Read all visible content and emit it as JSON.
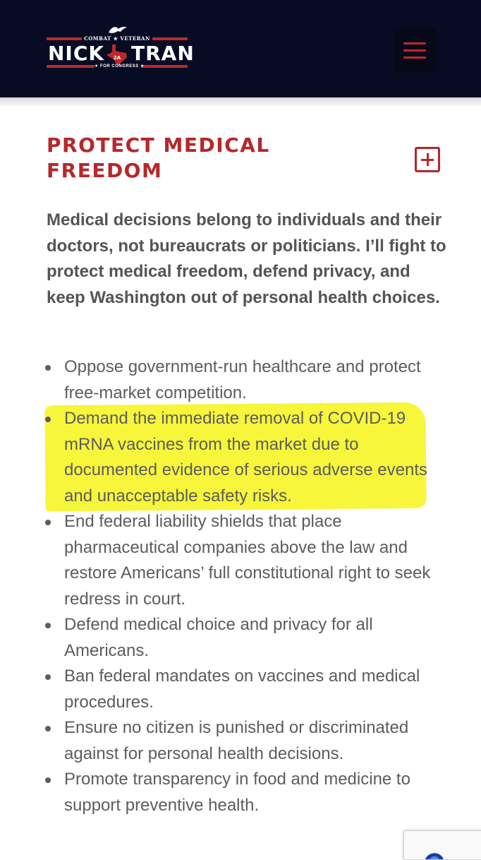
{
  "header": {
    "logo": {
      "tagline_top": "COMBAT ★ VETERAN",
      "name_first": "NICK",
      "name_last": "TRAN",
      "emblem_text": "2A",
      "tagline_bottom": "★ FOR CONGRESS ★"
    },
    "menu_icon": "hamburger-menu-icon"
  },
  "section": {
    "title": "PROTECT MEDICAL FREEDOM",
    "expand_icon": "plus-square-icon",
    "intro": "Medical decisions belong to individuals and their doctors, not bureaucrats or politicians. I’ll fight to protect medical freedom, defend privacy, and keep Washington out of personal health choices.",
    "items": [
      "Oppose government-run healthcare and protect free-market competition.",
      "Demand the immediate removal of COVID-19 mRNA vaccines from the market due to documented evidence of serious adverse events and unacceptable safety risks.",
      "End federal liability shields that place pharmaceutical companies above the law and restore Americans’ full constitutional right to seek redress in court.",
      "Defend medical choice and privacy for all Americans.",
      "Ban federal mandates on vaccines and medical procedures.",
      "Ensure no citizen is punished or discriminated against for personal health decisions.",
      "Promote transparency in food and medicine to support preventive health."
    ],
    "highlighted_item_index": 1
  },
  "colors": {
    "header_bg": "#070b24",
    "accent_red": "#b5282b",
    "body_text": "#5c5c61",
    "highlight": "#f7f63a"
  },
  "recaptcha": {
    "icon": "recaptcha-icon"
  }
}
